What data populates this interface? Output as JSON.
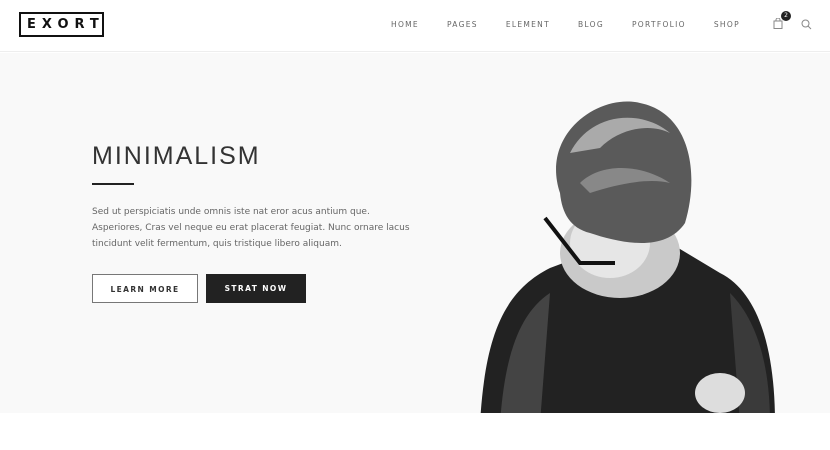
{
  "header": {
    "logo": "EXORT",
    "nav": [
      "HOME",
      "PAGES",
      "ELEMENT",
      "BLOG",
      "PORTFOLIO",
      "SHOP"
    ],
    "cart_count": "2",
    "icons": [
      "cart-icon",
      "search-icon"
    ]
  },
  "hero": {
    "title": "MINIMALISM",
    "text": "Sed ut perspiciatis unde omnis iste nat eror acus antium que. Asperiores, Cras vel neque eu erat placerat feugiat. Nunc ornare lacus tincidunt velit fermentum, quis tristique libero aliquam.",
    "learn_more": "LEARN MORE",
    "start_now": "STRAT NOW"
  }
}
